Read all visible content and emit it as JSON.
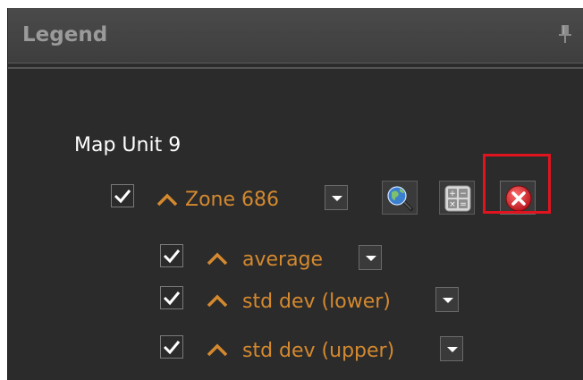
{
  "panel": {
    "title": "Legend"
  },
  "legend": {
    "map_unit": "Map Unit 9",
    "zone": {
      "label": "Zone 686",
      "checked": true
    },
    "sub_items": [
      {
        "label": "average",
        "checked": true
      },
      {
        "label": "std dev (lower)",
        "checked": true
      },
      {
        "label": "std dev (upper)",
        "checked": true
      }
    ]
  },
  "icons": {
    "pin": "pin-icon",
    "zoom_to": "globe-magnifier-icon",
    "calculator": "calculator-icon",
    "remove": "remove-x-icon"
  },
  "colors": {
    "panel_bg": "#2b2b2b",
    "label_orange": "#d4892f",
    "highlight_red": "#e0141e"
  }
}
